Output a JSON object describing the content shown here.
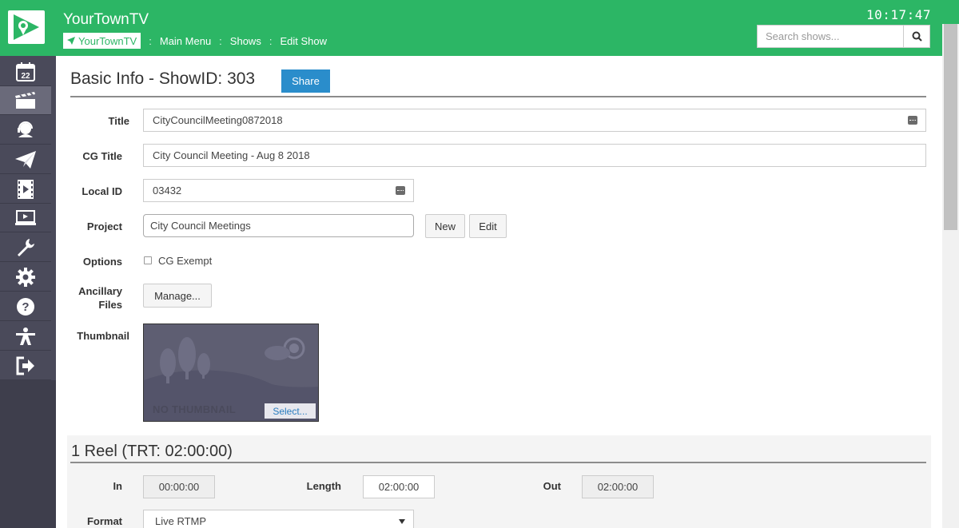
{
  "app": {
    "title": "YourTownTV",
    "clock": "10:17:47"
  },
  "breadcrumb": {
    "home": "YourTownTV",
    "sep": ":",
    "items": [
      "Main Menu",
      "Shows",
      "Edit Show"
    ]
  },
  "search": {
    "placeholder": "Search shows..."
  },
  "sidebar": {
    "items": [
      {
        "icon": "calendar-icon",
        "badge": "22"
      },
      {
        "icon": "clapperboard-icon"
      },
      {
        "icon": "headset-icon"
      },
      {
        "icon": "paper-plane-icon"
      },
      {
        "icon": "film-play-icon"
      },
      {
        "icon": "monitor-icon"
      },
      {
        "icon": "wrench-icon"
      },
      {
        "icon": "gear-icon"
      },
      {
        "icon": "help-icon"
      },
      {
        "icon": "person-icon"
      },
      {
        "icon": "logout-icon"
      }
    ]
  },
  "basic_info": {
    "title": "Basic Info - ShowID: 303",
    "share_label": "Share",
    "title_label": "Title",
    "title_value": "CityCouncilMeeting0872018",
    "cg_title_label": "CG Title",
    "cg_title_value": "City Council Meeting - Aug 8 2018",
    "local_id_label": "Local ID",
    "local_id_value": "03432",
    "project_label": "Project",
    "project_value": "City Council Meetings",
    "new_label": "New",
    "edit_label": "Edit",
    "options_label": "Options",
    "cg_exempt_label": "CG Exempt",
    "ancillary_label_1": "Ancillary",
    "ancillary_label_2": "Files",
    "manage_label": "Manage...",
    "thumbnail_label": "Thumbnail",
    "no_thumbnail_text": "NO THUMBNAIL",
    "select_label": "Select..."
  },
  "reel": {
    "title": "1 Reel (TRT: 02:00:00)",
    "in_label": "In",
    "in_value": "00:00:00",
    "length_label": "Length",
    "length_value": "02:00:00",
    "out_label": "Out",
    "out_value": "02:00:00",
    "format_label": "Format",
    "format_value": "Live RTMP"
  },
  "colors": {
    "header": "#2cb665",
    "sidebar": "#4a4a5a",
    "share": "#2a8dcb"
  }
}
